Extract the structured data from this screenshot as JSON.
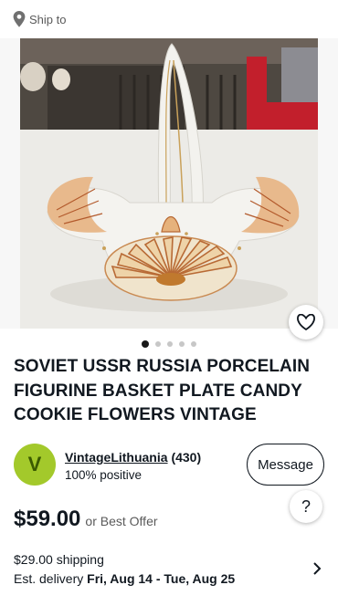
{
  "ship_bar": {
    "label": "Ship to",
    "icon": "location-pin-icon"
  },
  "gallery": {
    "image_count": 5,
    "active_index": 0,
    "like_icon": "heart-icon"
  },
  "listing": {
    "title": "SOVIET USSR RUSSIA PORCELAIN FIGURINE BASKET PLATE CANDY COOKIE FLOWERS VINTAGE",
    "price": "$59.00",
    "offer_text": "or Best Offer"
  },
  "seller": {
    "avatar_letter": "V",
    "name": "VintageLithuania",
    "feedback_count": "(430)",
    "positive": "100% positive",
    "message_label": "Message",
    "avatar_color": "#a3c92b"
  },
  "help": {
    "label": "?"
  },
  "shipping": {
    "cost": "$29.00 shipping",
    "delivery_prefix": "Est. delivery ",
    "delivery_dates": "Fri, Aug 14 - Tue, Aug 25",
    "chevron_icon": "chevron-right-icon"
  }
}
